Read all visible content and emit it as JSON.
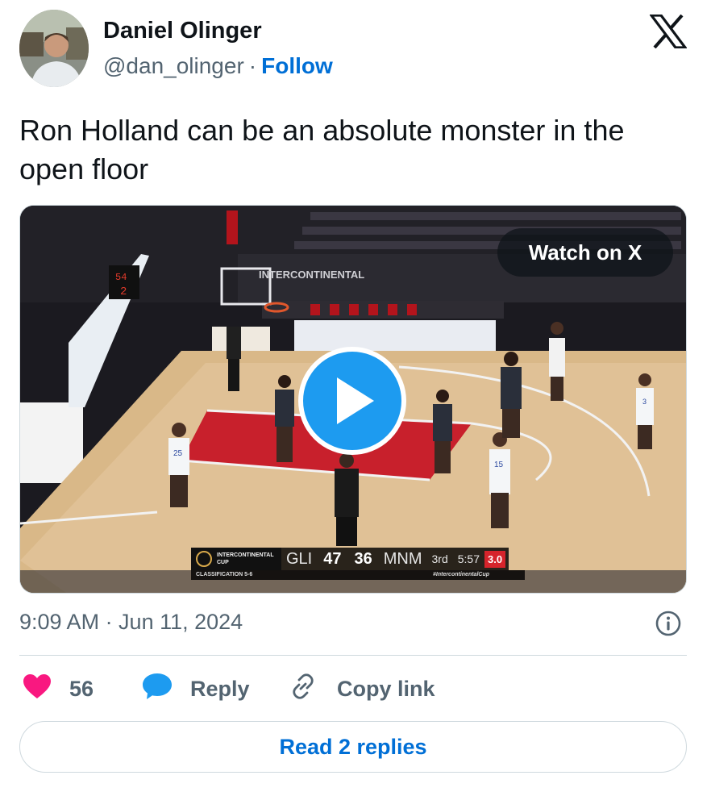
{
  "author": {
    "name": "Daniel Olinger",
    "handle": "@dan_olinger",
    "separator": "·",
    "follow_label": "Follow"
  },
  "tweet": {
    "text": "Ron Holland can be an absolute monster in the open floor"
  },
  "media": {
    "watch_label": "Watch on X",
    "scoreboard": {
      "event_line1": "INTERCONTINENTAL",
      "event_line2": "CUP",
      "classification": "CLASSIFICATION 5-6",
      "team_home": "GLI",
      "score_home": "47",
      "score_away": "36",
      "team_away": "MNM",
      "quarter": "3rd",
      "clock": "5:57",
      "shot_clock": "3.0",
      "hashtag": "#IntercontinentalCup"
    },
    "arena_banner": "INTERCONTINENTAL",
    "jersey_numbers": [
      "25",
      "15",
      "3"
    ]
  },
  "meta": {
    "timestamp": "9:09 AM · Jun 11, 2024"
  },
  "actions": {
    "like_count": "56",
    "reply_label": "Reply",
    "copy_label": "Copy link"
  },
  "read_replies_label": "Read 2 replies",
  "colors": {
    "accent_blue": "#1d9bf0",
    "link_blue": "#006fd6",
    "like_pink": "#f91880",
    "secondary_text": "#536471",
    "court_paint": "#c8202c"
  },
  "icons": {
    "x_logo": "x-logo-icon",
    "like": "heart-icon",
    "reply": "speech-bubble-icon",
    "copy": "link-icon",
    "info": "info-icon",
    "play": "play-icon"
  }
}
